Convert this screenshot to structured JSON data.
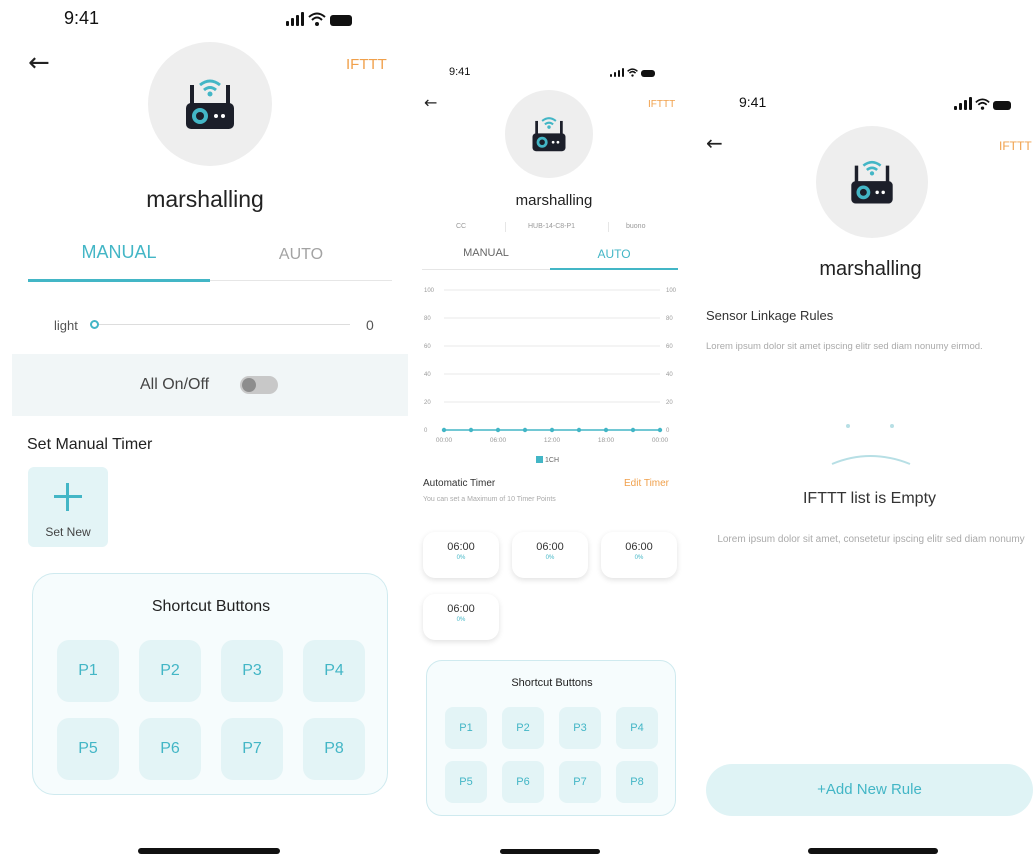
{
  "colors": {
    "accent": "#43b6c6",
    "ifttt": "#f0a04b",
    "toggle_off": "#c8c8c8",
    "panel_bg": "#f6fcfd"
  },
  "screen1": {
    "status_time": "9:41",
    "ifttt_label": "IFTTT",
    "device_name": "marshalling",
    "tabs": {
      "manual": "MANUAL",
      "auto": "AUTO",
      "active": "manual"
    },
    "light": {
      "label": "light",
      "value": "0",
      "level": 0
    },
    "all_onoff": {
      "label": "All On/Off",
      "on": false
    },
    "timer_section_title": "Set Manual Timer",
    "set_new": {
      "icon": "plus-icon",
      "label": "Set New"
    },
    "shortcut": {
      "title": "Shortcut Buttons",
      "buttons": [
        "P1",
        "P2",
        "P3",
        "P4",
        "P5",
        "P6",
        "P7",
        "P8"
      ]
    }
  },
  "screen2": {
    "status_time": "9:41",
    "ifttt_label": "IFTTT",
    "device_name": "marshalling",
    "info": [
      "CC",
      "HUB-14-C8-P1",
      "buono"
    ],
    "tabs": {
      "manual": "MANUAL",
      "auto": "AUTO",
      "active": "auto"
    },
    "chart_data": {
      "type": "line",
      "x": [
        "00:00",
        "06:00",
        "12:00",
        "18:00",
        "00:00"
      ],
      "y_ticks": [
        0,
        20,
        40,
        60,
        80,
        100
      ],
      "ylim": [
        0,
        100
      ],
      "grid": true,
      "legend_position": "bottom",
      "series": [
        {
          "name": "1CH",
          "values": [
            0,
            0,
            0,
            0,
            0,
            0,
            0,
            0,
            0
          ]
        }
      ]
    },
    "automatic_timer": {
      "title": "Automatic Timer",
      "edit_label": "Edit Timer",
      "subtitle": "You can set a Maximum of 10 Timer Points",
      "cards": [
        {
          "time": "06:00",
          "percent": "0%"
        },
        {
          "time": "06:00",
          "percent": "0%"
        },
        {
          "time": "06:00",
          "percent": "0%"
        },
        {
          "time": "06:00",
          "percent": "0%"
        }
      ]
    },
    "shortcut": {
      "title": "Shortcut Buttons",
      "buttons": [
        "P1",
        "P2",
        "P3",
        "P4",
        "P5",
        "P6",
        "P7",
        "P8"
      ]
    }
  },
  "screen3": {
    "status_time": "9:41",
    "ifttt_label": "IFTTT",
    "device_name": "marshalling",
    "sensor_rules_title": "Sensor Linkage Rules",
    "sensor_rules_desc": "Lorem ipsum dolor sit amet  ipscing elitr sed diam nonumy eirmod.",
    "empty_title": "IFTTT list is Empty",
    "empty_desc": "Lorem ipsum dolor sit amet, consetetur ipscing elitr sed diam nonumy",
    "add_rule_label": "+Add New Rule"
  }
}
